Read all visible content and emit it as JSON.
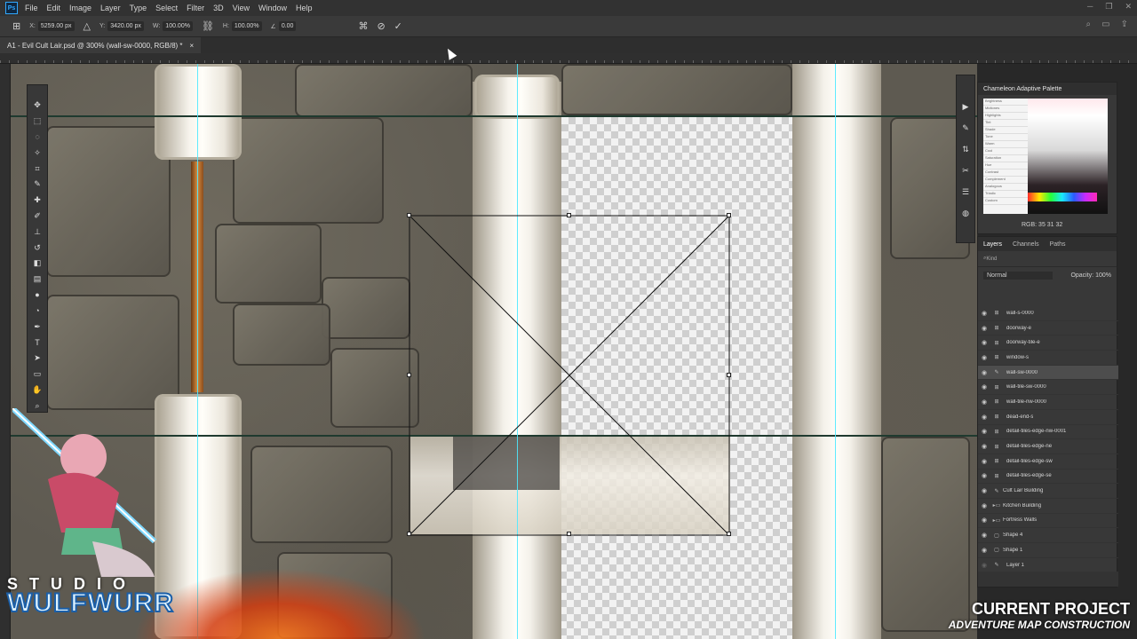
{
  "menubar": {
    "logo": "Ps",
    "items": [
      "File",
      "Edit",
      "Image",
      "Layer",
      "Type",
      "Select",
      "Filter",
      "3D",
      "View",
      "Window",
      "Help"
    ]
  },
  "options": {
    "x_label": "X:",
    "x_value": "5259.00 px",
    "y_label": "Y:",
    "y_value": "3420.00 px",
    "w_label": "W:",
    "w_value": "100.00%",
    "h_label": "H:",
    "h_value": "100.00%",
    "angle_value": "0.00"
  },
  "document": {
    "tab_title": "A1 - Evil Cult Lair.psd @ 300% (wall-sw-0000, RGB/8) *",
    "close": "×"
  },
  "palette": {
    "title": "Chameleon Adaptive Palette",
    "rgb": "RGB: 35 31 32",
    "rows": [
      "Brightness",
      "Midtones",
      "Highlights",
      "Tint",
      "Shade",
      "Tone",
      "Warm",
      "Cool",
      "Saturation",
      "Hue",
      "Contrast",
      "Complement",
      "Analogous",
      "Triadic",
      "Custom"
    ]
  },
  "layers": {
    "tabs": [
      "Layers",
      "Channels",
      "Paths"
    ],
    "search": "Kind",
    "blend": "Normal",
    "opacity_label": "Opacity:",
    "opacity_value": "100%",
    "items": [
      {
        "name": "wall-s-0000",
        "type": "layer"
      },
      {
        "name": "doorway-e",
        "type": "layer"
      },
      {
        "name": "doorway-tile-e",
        "type": "layer"
      },
      {
        "name": "window-s",
        "type": "layer"
      },
      {
        "name": "wall-sw-0000",
        "type": "layer",
        "selected": true
      },
      {
        "name": "wall-tile-sw-0000",
        "type": "layer"
      },
      {
        "name": "wall-tile-nw-0000",
        "type": "layer"
      },
      {
        "name": "dead-end-s",
        "type": "layer"
      },
      {
        "name": "detail-tiles-edge-nw-0001",
        "type": "layer"
      },
      {
        "name": "detail-tiles-edge-ne",
        "type": "layer"
      },
      {
        "name": "detail-tiles-edge-sw",
        "type": "layer"
      },
      {
        "name": "detail-tiles-edge-se",
        "type": "layer"
      },
      {
        "name": "Cult Lair Building",
        "type": "group"
      },
      {
        "name": "Kitchen Building",
        "type": "group"
      },
      {
        "name": "Fortress Walls",
        "type": "group"
      },
      {
        "name": "Shape 4",
        "type": "shape"
      },
      {
        "name": "Shape 1",
        "type": "shape"
      },
      {
        "name": "Layer 1",
        "type": "layer"
      }
    ]
  },
  "brand": {
    "studio": "STUDIO",
    "name": "WULFWURR"
  },
  "banner": {
    "line1": "CURRENT PROJECT",
    "line2": "ADVENTURE MAP CONSTRUCTION"
  },
  "colors": {
    "guide": "#4ee9ff",
    "panel": "#383838",
    "accent": "#31a8ff"
  }
}
